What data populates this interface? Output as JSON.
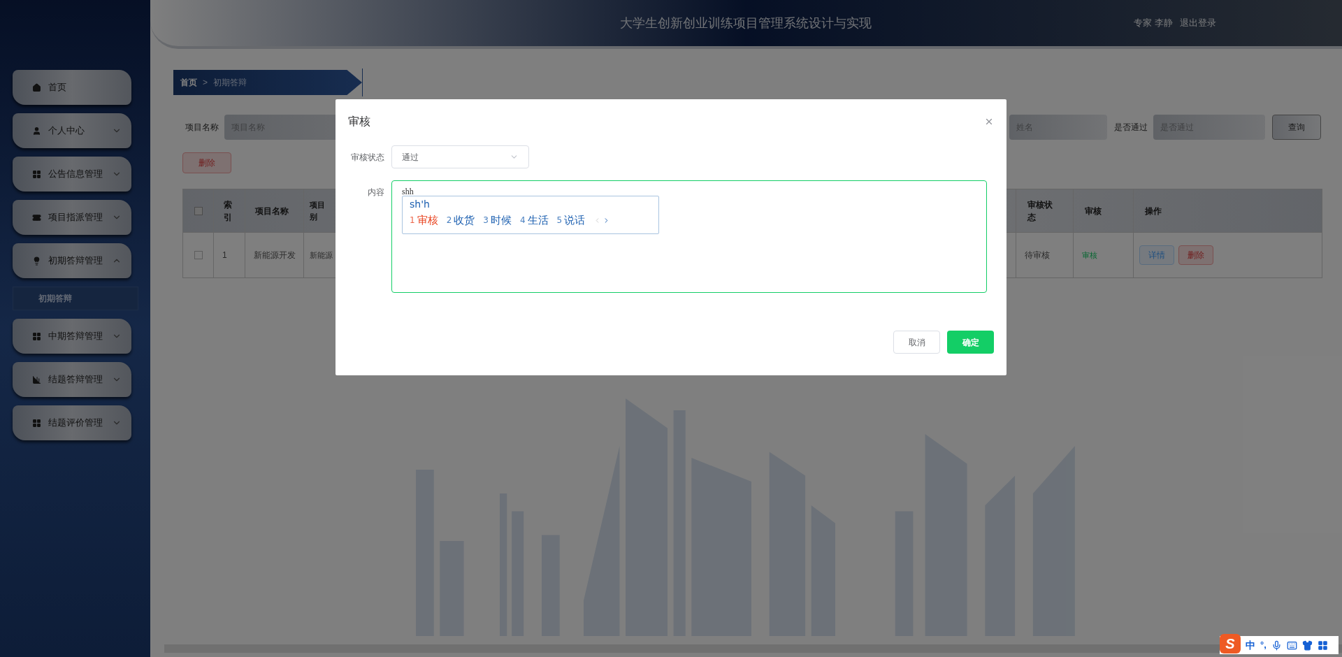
{
  "header": {
    "title": "大学生创新创业训练项目管理系统设计与实现",
    "user": "专家 李静",
    "logout": "退出登录"
  },
  "sidebar": {
    "items": [
      {
        "label": "首页"
      },
      {
        "label": "个人中心",
        "expanded": false
      },
      {
        "label": "公告信息管理",
        "expanded": false
      },
      {
        "label": "项目指派管理",
        "expanded": false
      },
      {
        "label": "初期答辩管理",
        "expanded": true,
        "children": [
          {
            "label": "初期答辩",
            "selected": true
          }
        ]
      },
      {
        "label": "中期答辩管理",
        "expanded": false
      },
      {
        "label": "结题答辩管理",
        "expanded": false
      },
      {
        "label": "结题评价管理",
        "expanded": false
      }
    ]
  },
  "breadcrumb": {
    "items": [
      "首页",
      "初期答辩"
    ],
    "separator": ">"
  },
  "search": {
    "fields": [
      {
        "label": "项目名称",
        "placeholder": "项目名称"
      },
      {
        "placeholder": "姓名"
      },
      {
        "label": "是否通过",
        "placeholder": "是否通过"
      }
    ],
    "button": "查询"
  },
  "delete_button": "删除",
  "table": {
    "header_checkbox": {
      "checked": false
    },
    "columns_left": [
      "索引",
      "项目名称",
      "项目别"
    ],
    "columns_right": [
      "审核状态",
      "审核",
      "操作"
    ],
    "rows": [
      {
        "checked": false,
        "cells": [
          "1",
          "新能源开发",
          "新能源"
        ],
        "status": "待审核",
        "review": "审核",
        "actions": [
          "详情",
          "删除"
        ]
      }
    ]
  },
  "modal": {
    "title": "审核",
    "status_label": "审核状态",
    "status_value": "通过",
    "content_label": "内容",
    "content_value": "shh",
    "cancel": "取消",
    "confirm": "确定"
  },
  "ime": {
    "composition": "sh'h",
    "candidates": [
      {
        "index": "1",
        "text": "审核",
        "selected": true
      },
      {
        "index": "2",
        "text": "收货",
        "selected": false
      },
      {
        "index": "3",
        "text": "时候",
        "selected": false
      },
      {
        "index": "4",
        "text": "生活",
        "selected": false
      },
      {
        "index": "5",
        "text": "说话",
        "selected": false
      }
    ],
    "status_bar": {
      "logo": "S",
      "mode": "中",
      "punctuation": "°,"
    }
  }
}
